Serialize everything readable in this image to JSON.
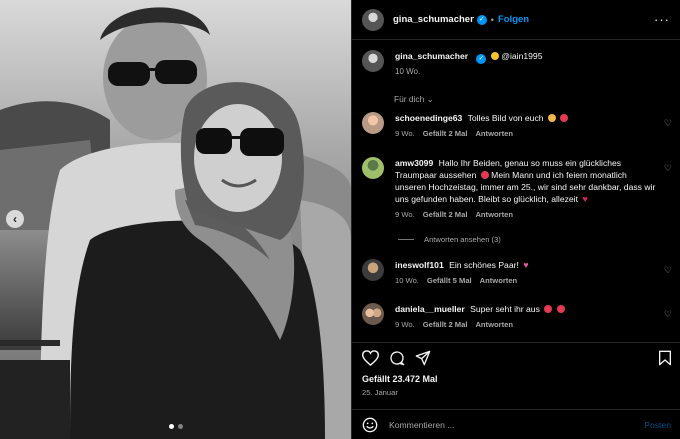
{
  "post": {
    "nav_arrow": "‹",
    "carousel_count": 2,
    "carousel_active": 0
  },
  "header": {
    "username": "gina_schumacher",
    "verified_icon": "verified-badge-icon",
    "separator": "•",
    "follow_label": "Folgen",
    "more_label": "···"
  },
  "caption": {
    "username": "gina_schumacher",
    "mention": "@iain1995",
    "time": "10 Wo."
  },
  "for_you_label": "Für dich",
  "comments": [
    {
      "username": "schoenedinge63",
      "text": "Tolles Bild von euch",
      "time": "9 Wo.",
      "likes": "Gefällt 2 Mal",
      "reply": "Antworten"
    },
    {
      "username": "amw3099",
      "text": "Hallo Ihr Beiden, genau so muss ein glückliches Traumpaar aussehen",
      "text2": "Mein Mann und ich feiern monatlich unseren Hochzeistag, immer am 25., wir sind sehr dankbar, dass wir uns gefunden haben. Bleibt so glücklich, allezeit",
      "time": "9 Wo.",
      "likes": "Gefällt 2 Mal",
      "reply": "Antworten",
      "view_replies": "Antworten ansehen (3)"
    },
    {
      "username": "ineswolf101",
      "text": "Ein schönes Paar!",
      "time": "10 Wo.",
      "likes": "Gefällt 5 Mal",
      "reply": "Antworten"
    },
    {
      "username": "daniela__mueller",
      "text": "Super seht ihr aus",
      "time": "9 Wo.",
      "likes": "Gefällt 2 Mal",
      "reply": "Antworten"
    }
  ],
  "footer": {
    "likes": "Gefällt 23.472 Mal",
    "date": "25. Januar",
    "comment_placeholder": "Kommentieren ...",
    "post_label": "Posten"
  },
  "colors": {
    "accent": "#0095f6",
    "background": "#000000",
    "secondary_text": "#a8a8a8"
  }
}
